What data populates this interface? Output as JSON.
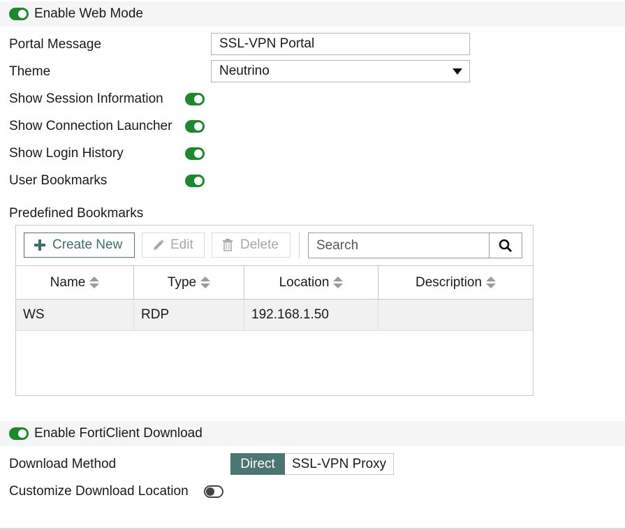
{
  "web_mode": {
    "label": "Enable Web Mode",
    "enabled": true
  },
  "fields": {
    "portal_message": {
      "label": "Portal Message",
      "value": "SSL-VPN Portal"
    },
    "theme": {
      "label": "Theme",
      "value": "Neutrino"
    }
  },
  "toggles": [
    {
      "label": "Show Session Information",
      "enabled": true
    },
    {
      "label": "Show Connection Launcher",
      "enabled": true
    },
    {
      "label": "Show Login History",
      "enabled": true
    },
    {
      "label": "User Bookmarks",
      "enabled": true
    }
  ],
  "bookmarks": {
    "title": "Predefined Bookmarks",
    "toolbar": {
      "create_label": "Create New",
      "edit_label": "Edit",
      "delete_label": "Delete",
      "search_placeholder": "Search"
    },
    "columns": [
      "Name",
      "Type",
      "Location",
      "Description"
    ],
    "rows": [
      {
        "name": "WS",
        "type": "RDP",
        "location": "192.168.1.50",
        "description": ""
      }
    ]
  },
  "forticlient": {
    "label": "Enable FortiClient Download",
    "enabled": true,
    "download_method": {
      "label": "Download Method",
      "options": [
        "Direct",
        "SSL-VPN Proxy"
      ],
      "selected": "Direct"
    },
    "customize_location": {
      "label": "Customize Download Location",
      "enabled": false
    }
  },
  "colors": {
    "toggle_on": "#1a8a2c",
    "accent": "#4a7570"
  }
}
